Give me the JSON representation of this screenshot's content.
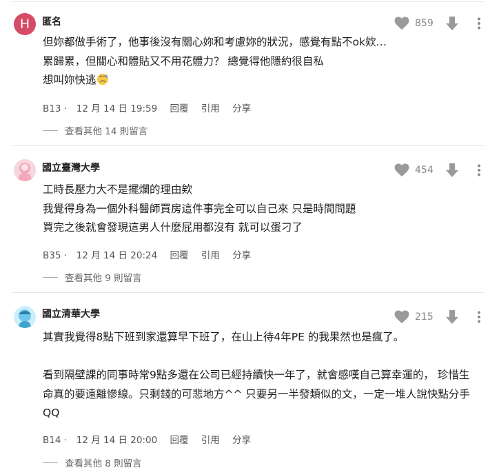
{
  "comments": [
    {
      "avatar_letter": "H",
      "author": "匿名",
      "likes": "859",
      "lines": [
        "但妳都做手術了，他事後沒有關心妳和考慮妳的狀況，感覺有點不ok欸…",
        "累歸累，但關心和體貼又不用花體力？ 總覺得他隱約很自私",
        "想叫妳快逃"
      ],
      "floor": "B13",
      "datetime": "12 月 14 日 19:59",
      "reply_label": "回覆",
      "quote_label": "引用",
      "share_label": "分享",
      "more_replies": "查看其他 14 則留言"
    },
    {
      "author": "國立臺灣大學",
      "likes": "454",
      "lines": [
        "工時長壓力大不是擺爛的理由欸",
        "我覺得身為一個外科醫師買房這件事完全可以自己來 只是時間問題",
        "買完之後就會發現這男人什麼屁用都沒有 就可以蛋刁了"
      ],
      "floor": "B35",
      "datetime": "12 月 14 日 20:24",
      "reply_label": "回覆",
      "quote_label": "引用",
      "share_label": "分享",
      "more_replies": "查看其他 9 則留言"
    },
    {
      "author": "國立清華大學",
      "likes": "215",
      "lines": [
        "其實我覺得8點下班到家還算早下班了，在山上待4年PE 的我果然也是瘋了。",
        "",
        "看到隔壁課的同事時常9點多還在公司已經持續快一年了，就會感嘆自己算幸運的， 珍惜生",
        "命真的要遠離慘線。只剩錢的可悲地方^^  只要另一半發類似的文，一定一堆人說快點分手",
        "QQ"
      ],
      "floor": "B14",
      "datetime": "12 月 14 日 20:00",
      "reply_label": "回覆",
      "quote_label": "引用",
      "share_label": "分享",
      "more_replies": "查看其他 8 則留言"
    }
  ],
  "colors": {
    "avatar_letter_bg": "#d64a66",
    "avatar_pink": "#f3a8bd",
    "avatar_blue": "#6cc7ea",
    "icon_gray": "#9a9a9a"
  },
  "icons": {
    "like": "heart-icon",
    "dislike": "thumb-down-arrow-icon",
    "menu": "more-vertical-icon",
    "emoji": "sweat-face-emoji"
  }
}
